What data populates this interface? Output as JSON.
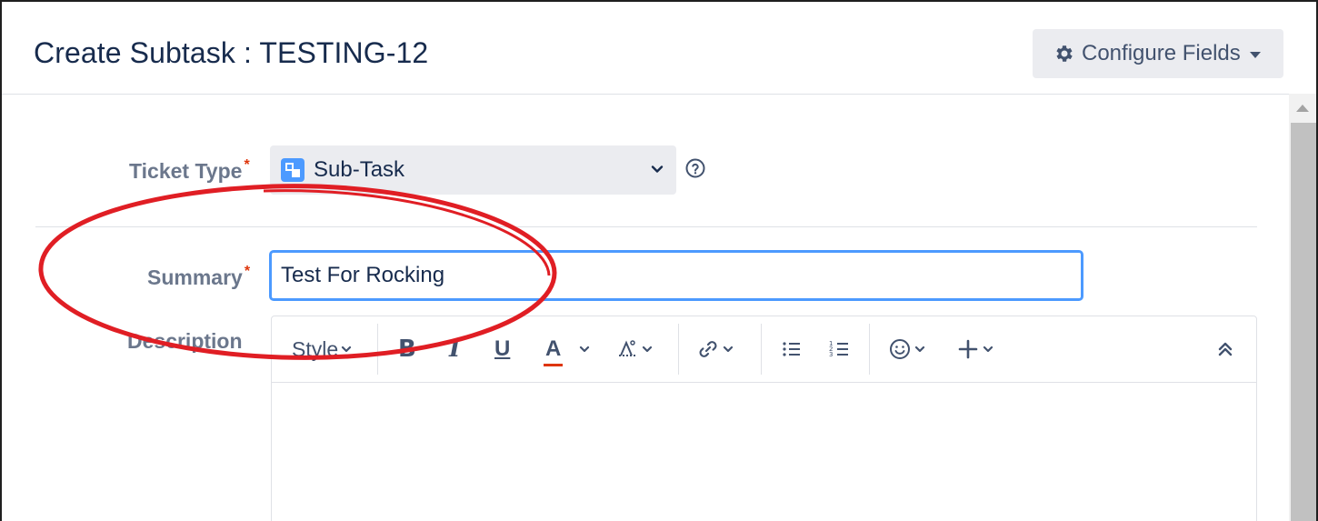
{
  "dialog": {
    "title": "Create Subtask : TESTING-12",
    "configure_fields_label": "Configure Fields"
  },
  "form": {
    "ticket_type": {
      "label": "Ticket Type",
      "required_marker": "*",
      "value": "Sub-Task"
    },
    "summary": {
      "label": "Summary",
      "required_marker": "*",
      "value": "Test For Rocking"
    },
    "description": {
      "label": "Description"
    }
  },
  "editor_toolbar": {
    "style_label": "Style",
    "bold_label": "B",
    "italic_label": "I",
    "underline_label": "U",
    "text_color_label": "A"
  },
  "colors": {
    "accent": "#4c9aff",
    "required": "#de350b",
    "annotation": "#e01e24",
    "label": "#6b778c"
  }
}
